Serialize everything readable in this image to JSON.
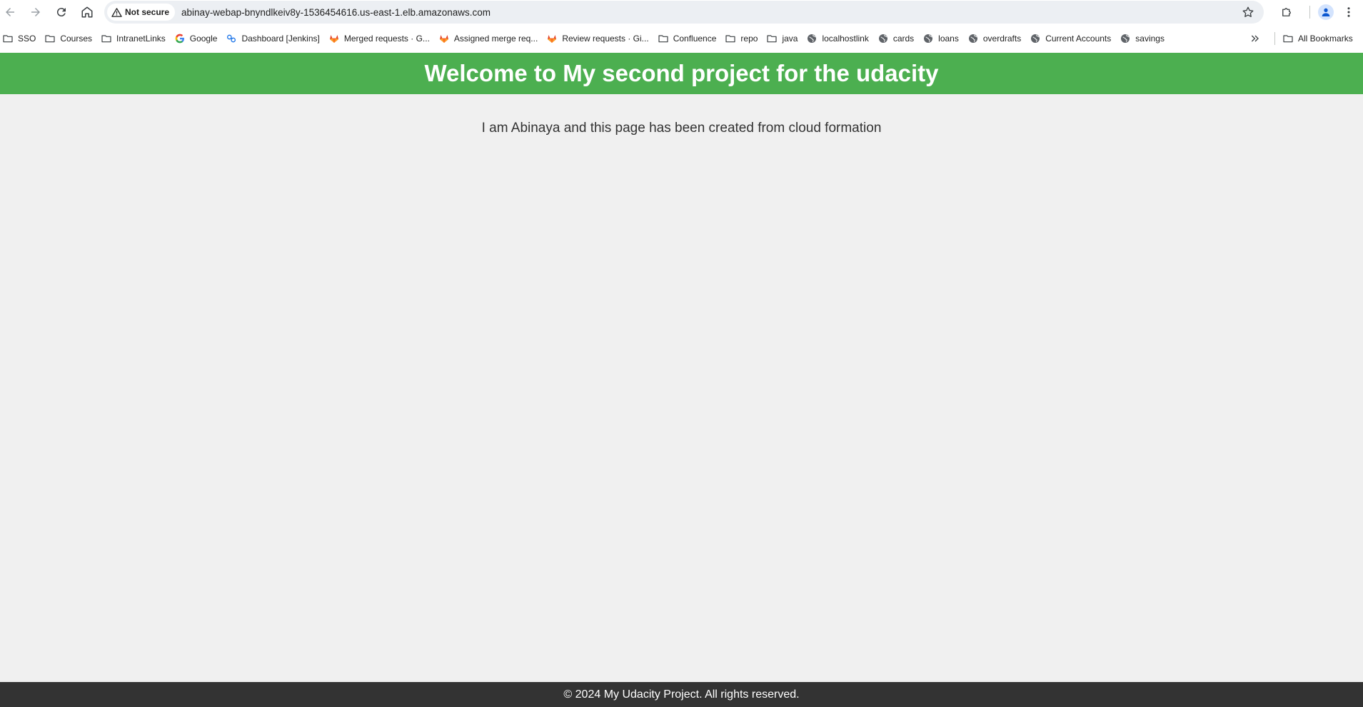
{
  "browser": {
    "security_label": "Not secure",
    "url": "abinay-webap-bnyndlkeiv8y-1536454616.us-east-1.elb.amazonaws.com",
    "bookmarks": [
      {
        "label": "SSO",
        "icon": "folder-icon"
      },
      {
        "label": "Courses",
        "icon": "folder-icon"
      },
      {
        "label": "IntranetLinks",
        "icon": "folder-icon"
      },
      {
        "label": "Google",
        "icon": "google-icon"
      },
      {
        "label": "Dashboard [Jenkins]",
        "icon": "jenkins-icon"
      },
      {
        "label": "Merged requests · G...",
        "icon": "gitlab-icon"
      },
      {
        "label": "Assigned merge req...",
        "icon": "gitlab-icon"
      },
      {
        "label": "Review requests · Gi...",
        "icon": "gitlab-icon"
      },
      {
        "label": "Confluence",
        "icon": "folder-icon"
      },
      {
        "label": "repo",
        "icon": "folder-icon"
      },
      {
        "label": "java",
        "icon": "folder-icon"
      },
      {
        "label": "localhostlink",
        "icon": "globe-icon"
      },
      {
        "label": "cards",
        "icon": "globe-icon"
      },
      {
        "label": "loans",
        "icon": "globe-icon"
      },
      {
        "label": "overdrafts",
        "icon": "globe-icon"
      },
      {
        "label": "Current Accounts",
        "icon": "globe-icon"
      },
      {
        "label": "savings",
        "icon": "globe-icon"
      }
    ],
    "all_bookmarks_label": "All Bookmarks"
  },
  "page": {
    "title": "Welcome to My second project for the udacity",
    "intro": "I am Abinaya and this page has been created from cloud formation",
    "footer": "© 2024 My Udacity Project. All rights reserved."
  },
  "colors": {
    "header_bg": "#4caf50",
    "footer_bg": "#333333",
    "page_bg": "#f0f0f0"
  }
}
